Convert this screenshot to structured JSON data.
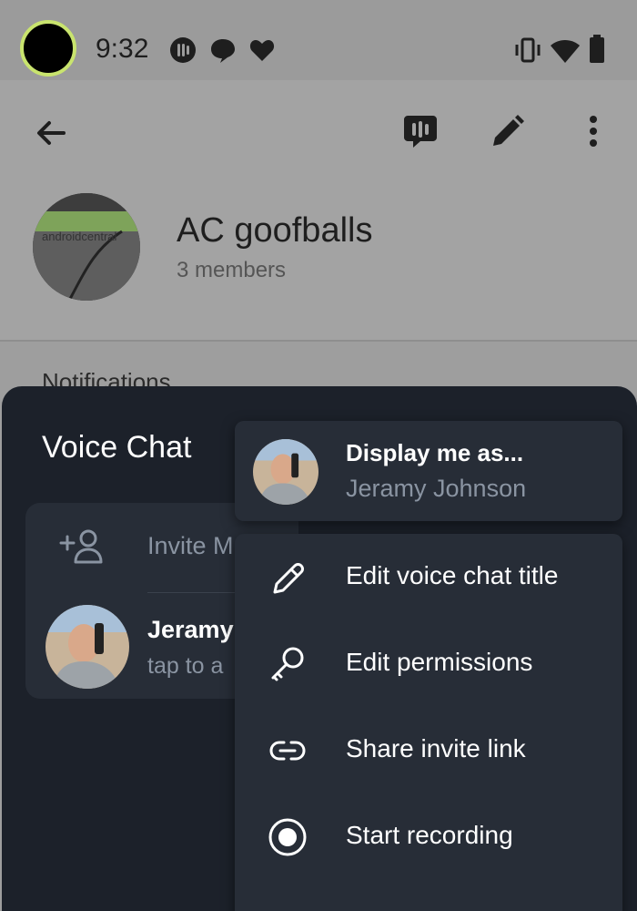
{
  "status_bar": {
    "time": "9:32"
  },
  "group": {
    "name": "AC goofballs",
    "members": "3 members",
    "avatar_text": "androidcentral"
  },
  "section": {
    "notifications": "Notifications"
  },
  "voice_chat": {
    "title": "Voice Chat",
    "invite_label": "Invite M",
    "participant": {
      "name": "Jeramy",
      "subtitle": "tap to a"
    }
  },
  "display_menu": {
    "label": "Display me as...",
    "value": "Jeramy Johnson"
  },
  "menu": {
    "items": [
      {
        "label": "Edit voice chat title",
        "icon": "pencil-icon"
      },
      {
        "label": "Edit permissions",
        "icon": "key-icon"
      },
      {
        "label": "Share invite link",
        "icon": "link-icon"
      },
      {
        "label": "Start recording",
        "icon": "record-icon"
      }
    ]
  },
  "colors": {
    "sheet_background": "#1c212a",
    "card_background": "#272d37",
    "secondary_text": "#8a94a2",
    "camera_ring": "#c9e46e"
  }
}
